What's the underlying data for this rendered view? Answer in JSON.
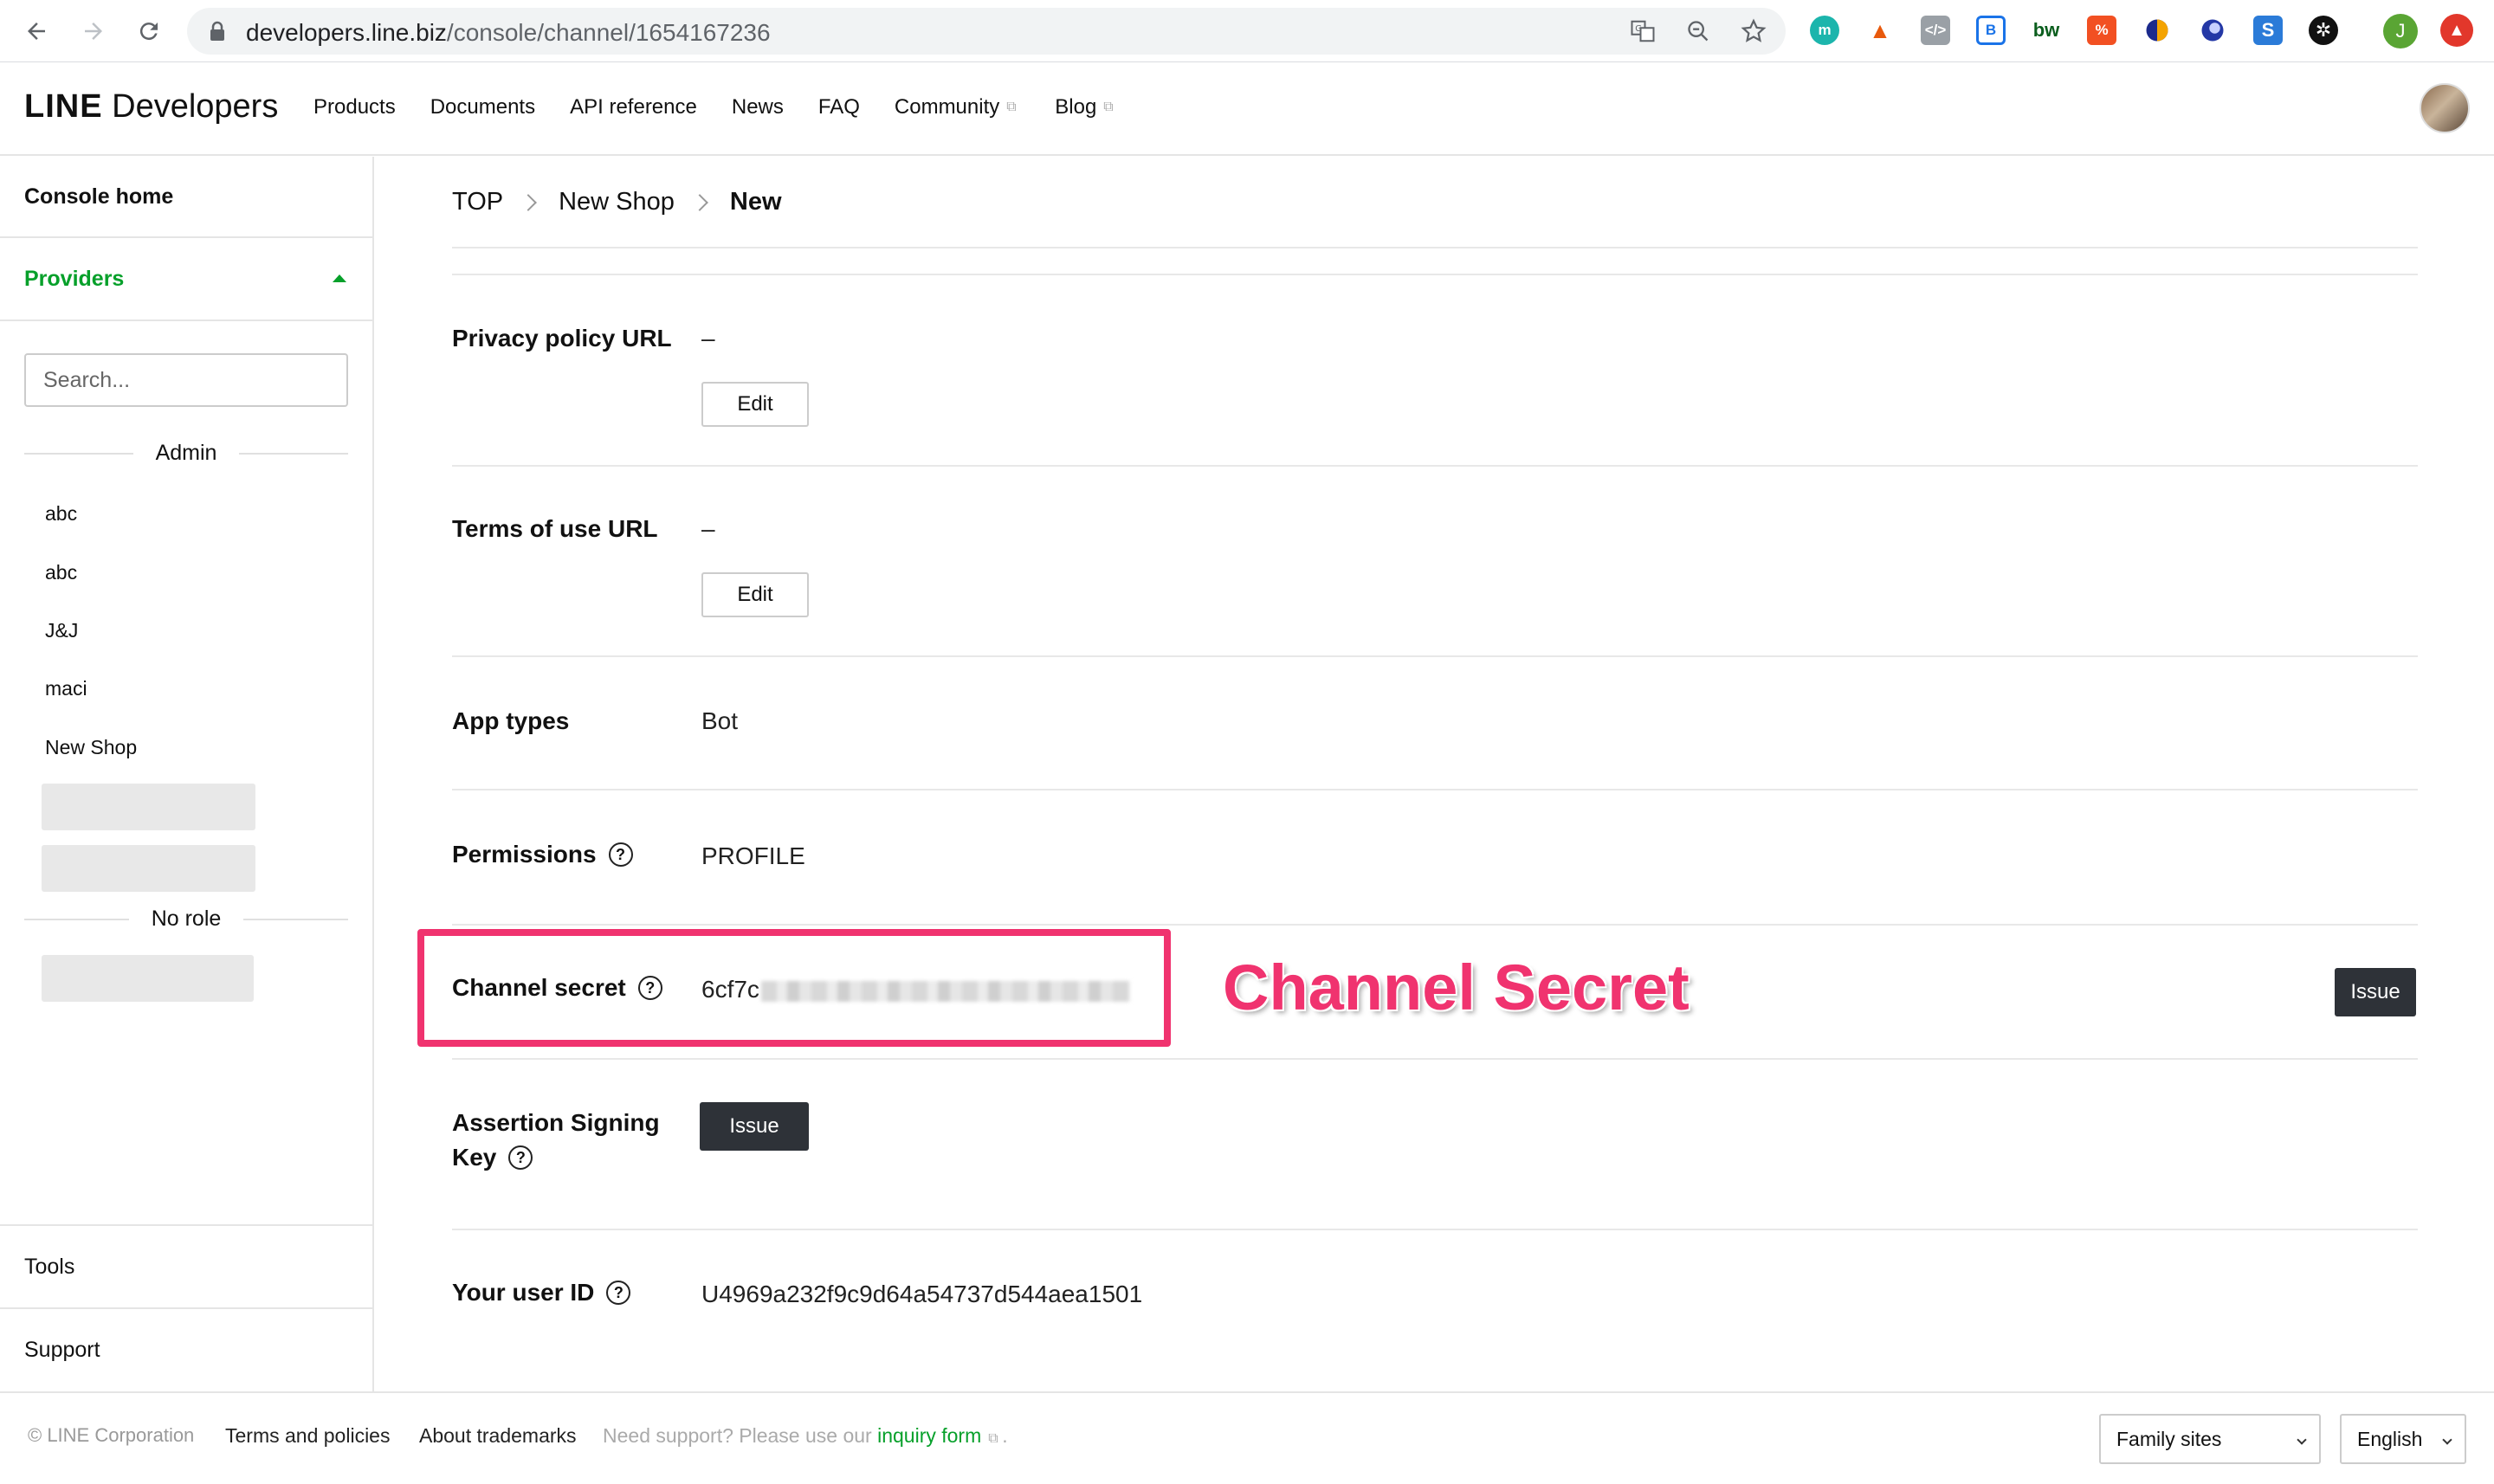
{
  "browser": {
    "url_domain": "developers.line.biz",
    "url_path": "/console/channel/1654167236",
    "profile_initial": "J",
    "extensions": [
      {
        "name": "m-ext",
        "label": "m",
        "color": "#1cb5ac"
      },
      {
        "name": "fire-ext",
        "label": "🔥",
        "color": "#ffffff"
      },
      {
        "name": "code-ext",
        "label": "</>",
        "color": "#9aa0a6"
      },
      {
        "name": "tab-ext",
        "label": "⊞",
        "color": "#1a73e8"
      },
      {
        "name": "bw-ext",
        "label": "bw",
        "color": "#ffffff"
      },
      {
        "name": "percent-ext",
        "label": "%",
        "color": "#f25022"
      },
      {
        "name": "circle-ext",
        "label": "◐",
        "color": "#ffffff"
      },
      {
        "name": "orb-ext",
        "label": "●",
        "color": "#ffffff"
      },
      {
        "name": "s-ext",
        "label": "S",
        "color": "#2b7bd8"
      },
      {
        "name": "gear-ext",
        "label": "✲",
        "color": "#111111"
      }
    ]
  },
  "header": {
    "logo_bold": "LINE",
    "logo_text": "Developers",
    "nav": [
      {
        "label": "Products",
        "external": false
      },
      {
        "label": "Documents",
        "external": false
      },
      {
        "label": "API reference",
        "external": false
      },
      {
        "label": "News",
        "external": false
      },
      {
        "label": "FAQ",
        "external": false
      },
      {
        "label": "Community",
        "external": true
      },
      {
        "label": "Blog",
        "external": true
      }
    ]
  },
  "sidebar": {
    "console_home": "Console home",
    "providers": "Providers",
    "search_placeholder": "Search...",
    "admin_label": "Admin",
    "admin_items": [
      "abc",
      "abc",
      "J&J",
      "maci",
      "New Shop"
    ],
    "no_role_label": "No role",
    "tools": "Tools",
    "support": "Support"
  },
  "breadcrumb": [
    "TOP",
    "New Shop",
    "New"
  ],
  "fields": {
    "privacy_label": "Privacy policy URL",
    "privacy_value": "–",
    "terms_label": "Terms of use URL",
    "terms_value": "–",
    "edit_label": "Edit",
    "app_types_label": "App types",
    "app_types_value": "Bot",
    "permissions_label": "Permissions",
    "permissions_value": "PROFILE",
    "channel_secret_label": "Channel secret",
    "channel_secret_value": "6cf7c",
    "issue_label": "Issue",
    "assertion_label_1": "Assertion Signing",
    "assertion_label_2": "Key",
    "user_id_label": "Your user ID",
    "user_id_value": "U4969a232f9c9d64a54737d544aea1501"
  },
  "annotation": {
    "text": "Channel Secret",
    "color": "#f0336f"
  },
  "footer": {
    "copyright": "© LINE Corporation",
    "terms": "Terms and policies",
    "trademarks": "About trademarks",
    "support_prefix": "Need support? Please use our",
    "inquiry_link": "inquiry form",
    "support_suffix": ".",
    "family_sites": "Family sites",
    "language": "English"
  },
  "colors": {
    "brand_green": "#06a02a",
    "dark_button": "#2e3238"
  }
}
